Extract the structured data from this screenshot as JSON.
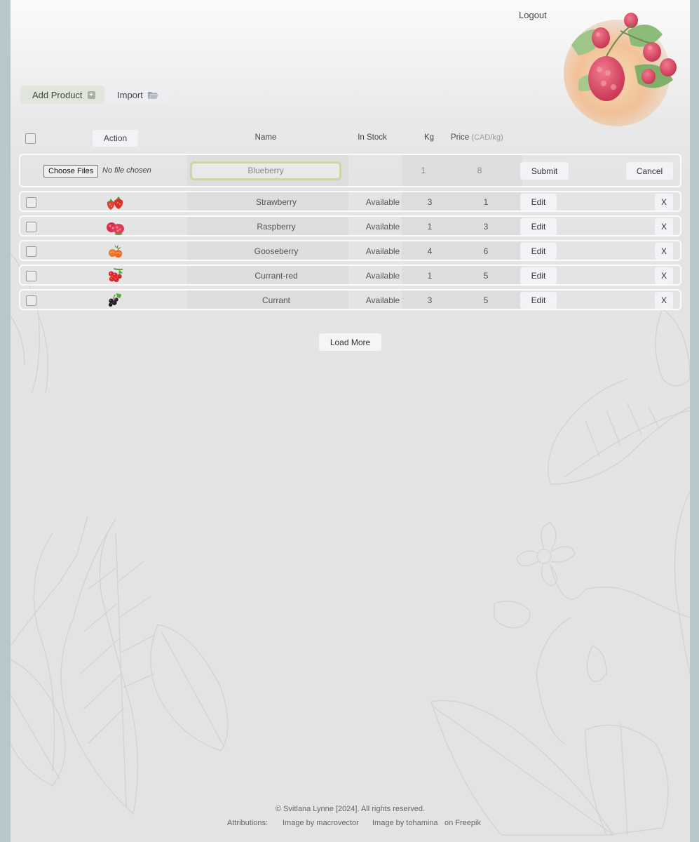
{
  "header": {
    "logout_label": "Logout",
    "add_product_label": "Add Product",
    "import_label": "Import"
  },
  "table": {
    "headers": {
      "action": "Action",
      "name": "Name",
      "in_stock": "In Stock",
      "kg": "Kg",
      "price": "Price",
      "price_unit": "(CAD/kg)"
    },
    "edit_row": {
      "file_button": "Choose Files",
      "file_status": "No file chosen",
      "name_value": "Blueberry",
      "kg": "1",
      "price": "8",
      "submit_label": "Submit",
      "cancel_label": "Cancel"
    },
    "rows": [
      {
        "name": "Strawberry",
        "stock": "Available",
        "kg": "3",
        "price": "1",
        "icon": "strawberry-icon"
      },
      {
        "name": "Raspberry",
        "stock": "Available",
        "kg": "1",
        "price": "3",
        "icon": "raspberry-icon"
      },
      {
        "name": "Gooseberry",
        "stock": "Available",
        "kg": "4",
        "price": "6",
        "icon": "gooseberry-icon"
      },
      {
        "name": "Currant-red",
        "stock": "Available",
        "kg": "1",
        "price": "5",
        "icon": "red-currant-icon"
      },
      {
        "name": "Currant",
        "stock": "Available",
        "kg": "3",
        "price": "5",
        "icon": "black-currant-icon"
      }
    ],
    "edit_label": "Edit",
    "delete_label": "X"
  },
  "load_more_label": "Load More",
  "footer": {
    "copyright": "© Svitlana Lynne [2024]. All rights reserved.",
    "attributions_label": "Attributions:",
    "attribution_1": "Image by macrovector",
    "attribution_2": "Image by tohamina",
    "attribution_3": "on Freepik"
  }
}
